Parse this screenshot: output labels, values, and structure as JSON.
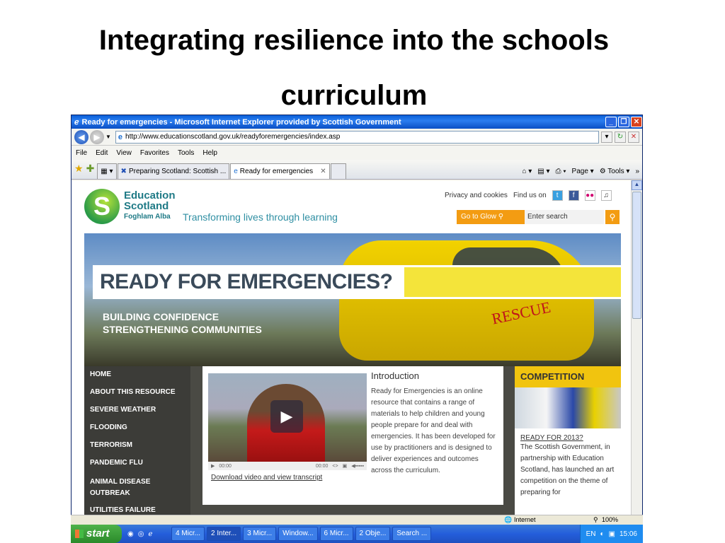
{
  "slide": {
    "title_line1": "Integrating resilience into the schools",
    "title_line2": "curriculum"
  },
  "browser": {
    "window_title": "Ready for emergencies - Microsoft Internet Explorer provided by Scottish Government",
    "address": "http://www.educationscotland.gov.uk/readyforemergencies/index.asp",
    "menu": [
      "File",
      "Edit",
      "View",
      "Favorites",
      "Tools",
      "Help"
    ],
    "tabs": [
      {
        "label": "Preparing Scotland: Scottish ..."
      },
      {
        "label": "Ready for emergencies"
      }
    ],
    "command_bar": {
      "page": "Page",
      "tools": "Tools"
    },
    "status": {
      "zone": "Internet",
      "zoom": "100%"
    }
  },
  "site": {
    "logo_line1": "Education",
    "logo_line2": "Scotland",
    "logo_sub": "Foghlam Alba",
    "tagline": "Transforming lives through learning",
    "links": [
      "Privacy and cookies",
      "Find us on"
    ],
    "glow_button": "Go to Glow",
    "search_placeholder": "Enter search",
    "hero_title": "READY FOR EMERGENCIES?",
    "hero_sub1": "BUILDING CONFIDENCE",
    "hero_sub2": "STRENGTHENING COMMUNITIES",
    "hero_rescue": "RESCUE",
    "nav": [
      "HOME",
      "ABOUT THIS RESOURCE",
      "SEVERE WEATHER",
      "FLOODING",
      "TERRORISM",
      "PANDEMIC FLU",
      "ANIMAL DISEASE OUTBREAK",
      "UTILITIES FAILURE"
    ],
    "video": {
      "time_start": "00:00",
      "time_end": "00:00",
      "link": "Download video and view transcript"
    },
    "intro_title": "Introduction",
    "intro_body": "Ready for Emergencies is an online resource that contains a range of materials to help children and young people prepare for and deal with emergencies. It has been developed for use by practitioners and is designed to deliver experiences and outcomes across the curriculum.",
    "competition": {
      "title": "COMPETITION",
      "link": "READY FOR 2013?",
      "body": "The Scottish Government, in partnership with Education Scotland, has launched an art competition on the theme of preparing for"
    }
  },
  "taskbar": {
    "start": "start",
    "buttons": [
      "4 Micr...",
      "2 Inter...",
      "3 Micr...",
      "Window...",
      "6 Micr...",
      "2 Obje...",
      "Search ..."
    ],
    "lang": "EN",
    "clock": "15:06"
  }
}
